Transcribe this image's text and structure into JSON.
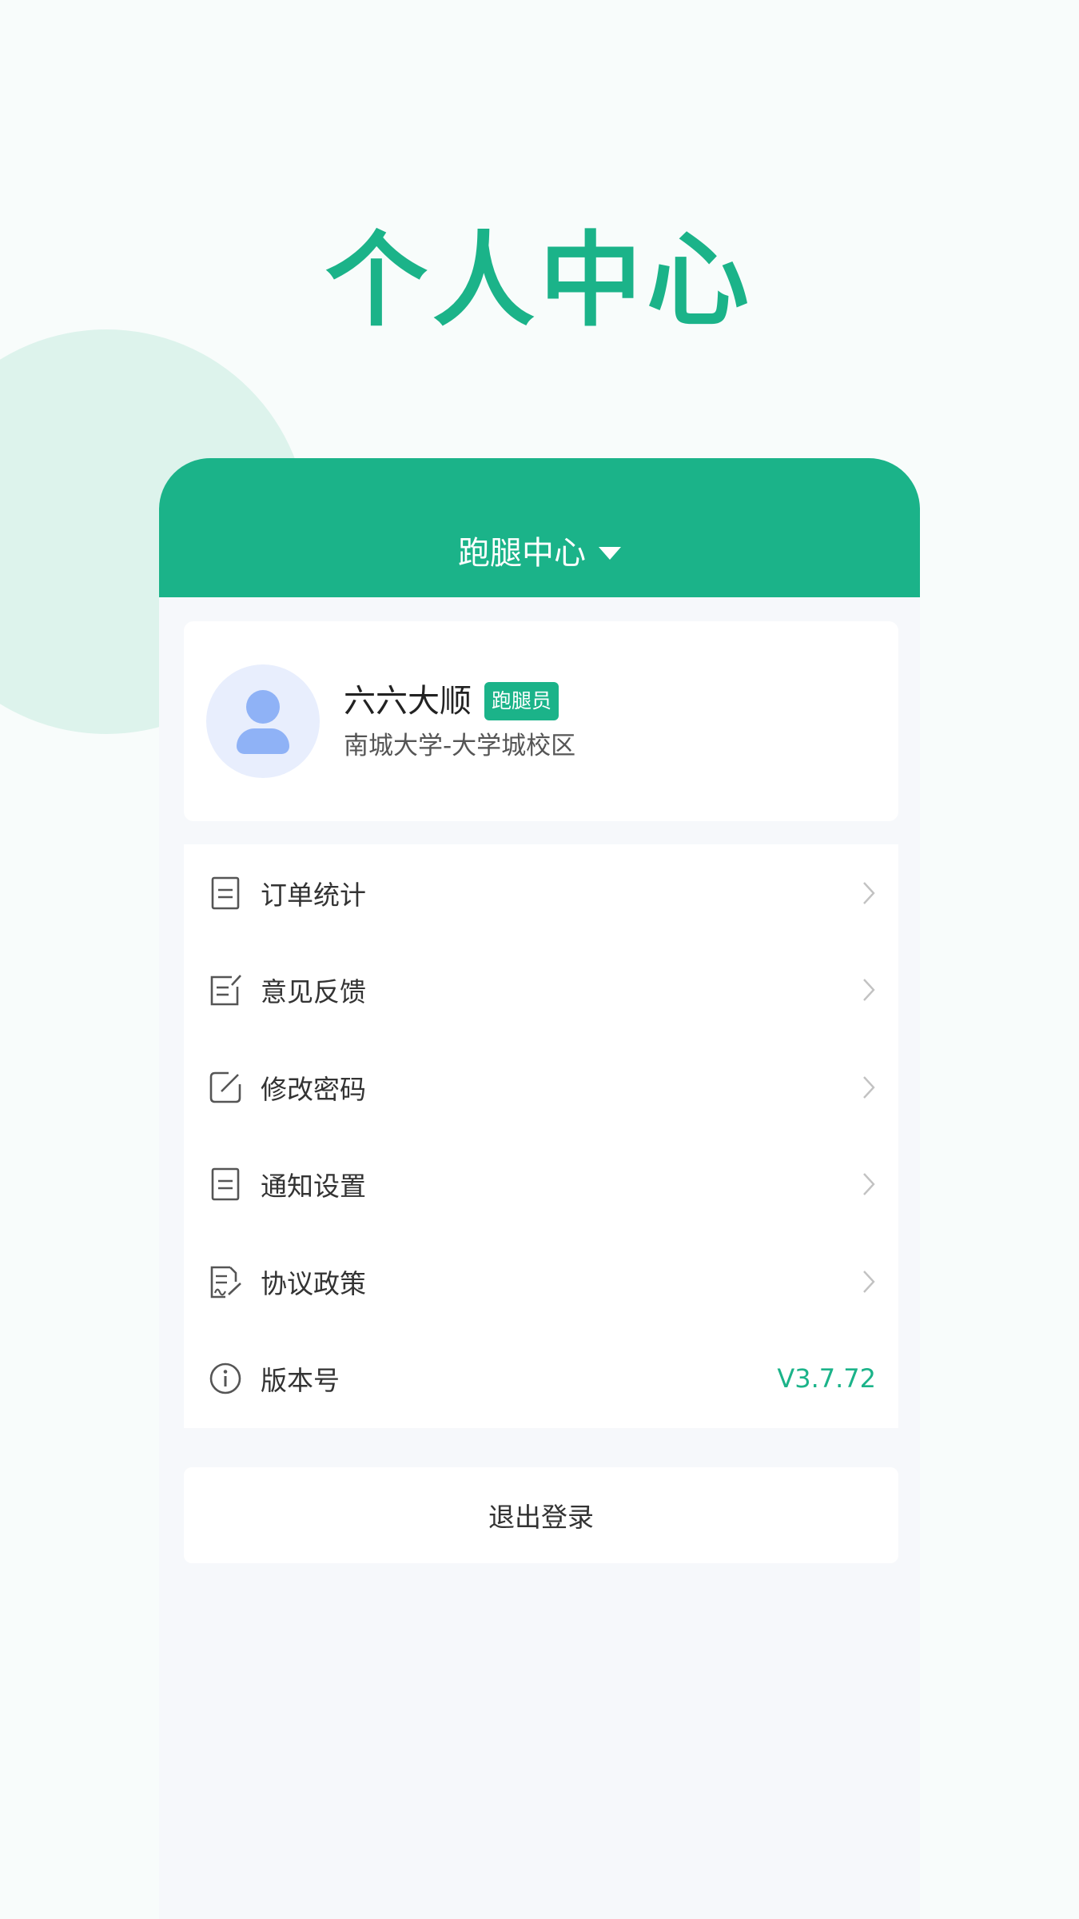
{
  "page": {
    "title": "个人中心"
  },
  "header": {
    "switch_label": "跑腿中心"
  },
  "profile": {
    "name": "六六大顺",
    "role_badge": "跑腿员",
    "school": "南城大学-大学城校区"
  },
  "menu": {
    "items": [
      {
        "label": "订单统计",
        "icon": "document-icon"
      },
      {
        "label": "意见反馈",
        "icon": "feedback-edit-icon"
      },
      {
        "label": "修改密码",
        "icon": "pencil-square-icon"
      },
      {
        "label": "通知设置",
        "icon": "document-icon"
      },
      {
        "label": "协议政策",
        "icon": "agreement-sign-icon"
      },
      {
        "label": "版本号",
        "icon": "info-icon",
        "value": "V3.7.72"
      }
    ]
  },
  "logout": {
    "label": "退出登录"
  },
  "colors": {
    "accent": "#1bb389",
    "decor": "#ddf3ec",
    "avatar": "#8fb2f6"
  }
}
